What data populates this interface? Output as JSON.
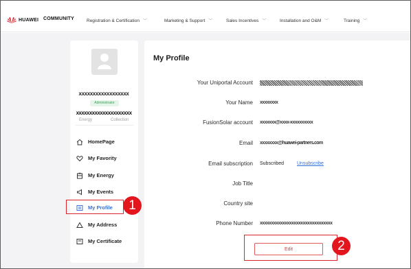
{
  "header": {
    "brand": "HUAWEI",
    "community": "COMMUNITY",
    "nav": [
      {
        "label": "Registration & Certification"
      },
      {
        "label": "Marketing & Support"
      },
      {
        "label": "Sales Incentives"
      },
      {
        "label": "Installation and O&M"
      },
      {
        "label": "Training"
      }
    ]
  },
  "sidebar": {
    "username": "xxxxxxxxxxxxxxxxxx",
    "role": "Administrator",
    "user_id": "xxxxxxxxxxxxxxxxxxxxx",
    "tabs": [
      "Energy",
      "Collection"
    ],
    "menu": [
      {
        "label": "HomePage",
        "icon": "home-icon"
      },
      {
        "label": "My Favority",
        "icon": "heart-icon"
      },
      {
        "label": "My Energy",
        "icon": "battery-icon"
      },
      {
        "label": "My Events",
        "icon": "megaphone-icon"
      },
      {
        "label": "My Profile",
        "icon": "profile-card-icon",
        "active": true
      },
      {
        "label": "My Address",
        "icon": "address-icon"
      },
      {
        "label": "My Certificate",
        "icon": "certificate-icon"
      }
    ]
  },
  "profile": {
    "title": "My Profile",
    "fields": [
      {
        "label": "Your Uniportal Account",
        "value": ""
      },
      {
        "label": "Your Name",
        "value": "xxxxxxxx"
      },
      {
        "label": "FusionSolar account",
        "value": "xxxxxxx@xxxx-xxxxxxxxxx"
      },
      {
        "label": "Email",
        "value": "xxxxxxxx@huawei-partners.com"
      },
      {
        "label": "Email subscription",
        "value": "Subscribed",
        "action": "Unsubscribe"
      },
      {
        "label": "Job Title",
        "value": ""
      },
      {
        "label": "Country site",
        "value": ""
      },
      {
        "label": "Phone Number",
        "value": "xxxxxxxxxxxxxxxxxxxxxxxxxxxxxxxx"
      }
    ],
    "edit_label": "Edit"
  },
  "annotations": {
    "marker_1": "1",
    "marker_2": "2",
    "accent_color": "#d8232a"
  }
}
